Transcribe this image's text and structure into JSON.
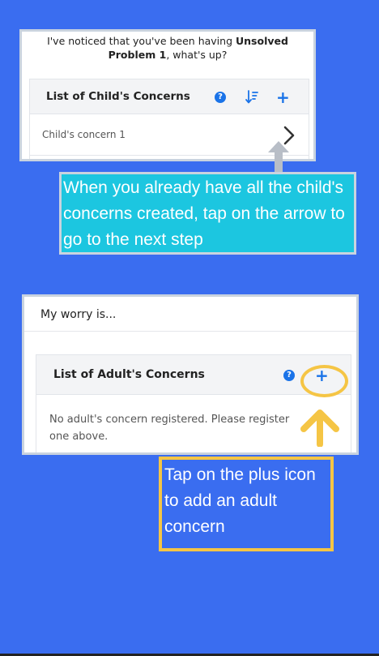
{
  "screen1": {
    "intro_prefix": "I've noticed that you've been having",
    "problem_name": "Unsolved Problem 1",
    "intro_suffix": ", what's up?",
    "card_title": "List of Child's Concerns",
    "help_icon": "question-circle-icon",
    "sort_icon": "sort-descending-icon",
    "add_icon": "plus-icon",
    "help_glyph": "?",
    "add_glyph": "+",
    "items": [
      {
        "label": "Child's concern 1",
        "icon": "chevron-right-icon"
      }
    ]
  },
  "callout1": {
    "text": "When you already have all the child's concerns created, tap on the arrow to go to the next step",
    "color": "#1cc6e0"
  },
  "screen2": {
    "worry_label": "My worry is...",
    "card_title": "List of Adult's Concerns",
    "help_glyph": "?",
    "add_glyph": "+",
    "empty_message": "No adult's concern registered. Please register one above."
  },
  "callout2": {
    "text": "Tap on the plus icon to add an adult concern",
    "border_color": "#f5c545"
  },
  "colors": {
    "background": "#3a6df0",
    "accent": "#1a73e8",
    "highlight": "#f5c545",
    "pointer_gray": "#b8bec7"
  }
}
